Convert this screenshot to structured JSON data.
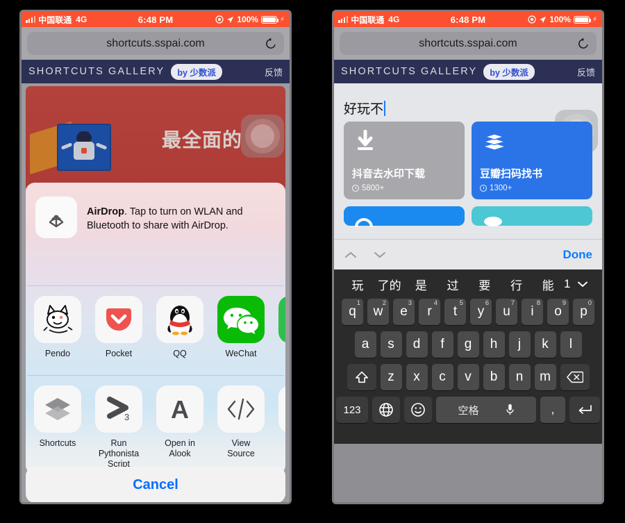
{
  "statusbar": {
    "carrier": "中国联通",
    "network": "4G",
    "time": "6:48 PM",
    "battery_percent": "100%",
    "location_icon": "location-arrow-icon",
    "alarm_icon": "do-not-disturb-icon",
    "charging_icon": "lightning-bolt-icon"
  },
  "browser": {
    "url": "shortcuts.sspai.com",
    "reload_icon": "reload-icon"
  },
  "site_header": {
    "brand": "SHORTCUTS GALLERY",
    "by_pill": "by 少数派",
    "feedback": "反馈"
  },
  "left_phone": {
    "banner": {
      "headline": "最全面的"
    },
    "assistive_touch": "assistive-touch-button",
    "share_sheet": {
      "airdrop": {
        "title": "AirDrop",
        "description": ". Tap to turn on WLAN and Bluetooth to share with AirDrop.",
        "icon": "airdrop-icon"
      },
      "apps": [
        {
          "label": "Pendo",
          "icon": "pendo-icon"
        },
        {
          "label": "Pocket",
          "icon": "pocket-icon"
        },
        {
          "label": "QQ",
          "icon": "qq-icon"
        },
        {
          "label": "WeChat",
          "icon": "wechat-icon"
        },
        {
          "label": "",
          "icon": "green-app-icon"
        }
      ],
      "actions": [
        {
          "label": "Shortcuts",
          "icon": "shortcuts-icon"
        },
        {
          "label": "Run Pythonista Script",
          "icon": "pythonista-icon"
        },
        {
          "label": "Open in Alook",
          "icon": "alook-icon"
        },
        {
          "label": "View Source",
          "icon": "view-source-icon"
        },
        {
          "label": "",
          "icon": "more-icon"
        }
      ],
      "cancel": "Cancel"
    }
  },
  "right_phone": {
    "search_value": "好玩不",
    "assistive_touch": "assistive-touch-button",
    "cards": [
      {
        "title": "抖音去水印下载",
        "count": "5800+",
        "color": "#a7a7ac",
        "icon": "download-icon"
      },
      {
        "title": "豆瓣扫码找书",
        "count": "1300+",
        "color": "#2a74e8",
        "icon": "books-icon"
      },
      {
        "title": "",
        "count": "",
        "color": "#1a8af0",
        "icon": "circle-icon"
      },
      {
        "title": "",
        "count": "",
        "color": "#4ec7d4",
        "icon": "disc-icon"
      }
    ],
    "accessory": {
      "prev_icon": "chevron-up-icon",
      "next_icon": "chevron-down-icon",
      "done": "Done"
    },
    "keyboard": {
      "candidates": [
        "玩",
        "了的",
        "是",
        "过",
        "要",
        "行",
        "能",
        "1"
      ],
      "expand_icon": "chevron-down-icon",
      "row1": [
        {
          "k": "q",
          "n": "1"
        },
        {
          "k": "w",
          "n": "2"
        },
        {
          "k": "e",
          "n": "3"
        },
        {
          "k": "r",
          "n": "4"
        },
        {
          "k": "t",
          "n": "5"
        },
        {
          "k": "y",
          "n": "6"
        },
        {
          "k": "u",
          "n": "7"
        },
        {
          "k": "i",
          "n": "8"
        },
        {
          "k": "o",
          "n": "9"
        },
        {
          "k": "p",
          "n": "0"
        }
      ],
      "row2": [
        "a",
        "s",
        "d",
        "f",
        "g",
        "h",
        "j",
        "k",
        "l"
      ],
      "row3": [
        "z",
        "x",
        "c",
        "v",
        "b",
        "n",
        "m"
      ],
      "shift_icon": "shift-icon",
      "backspace_icon": "backspace-icon",
      "numeric_label": "123",
      "globe_icon": "globe-icon",
      "emoji_icon": "emoji-icon",
      "space_label": "空格",
      "mic_icon": "microphone-icon",
      "comma_label": ",",
      "return_icon": "return-icon"
    }
  }
}
